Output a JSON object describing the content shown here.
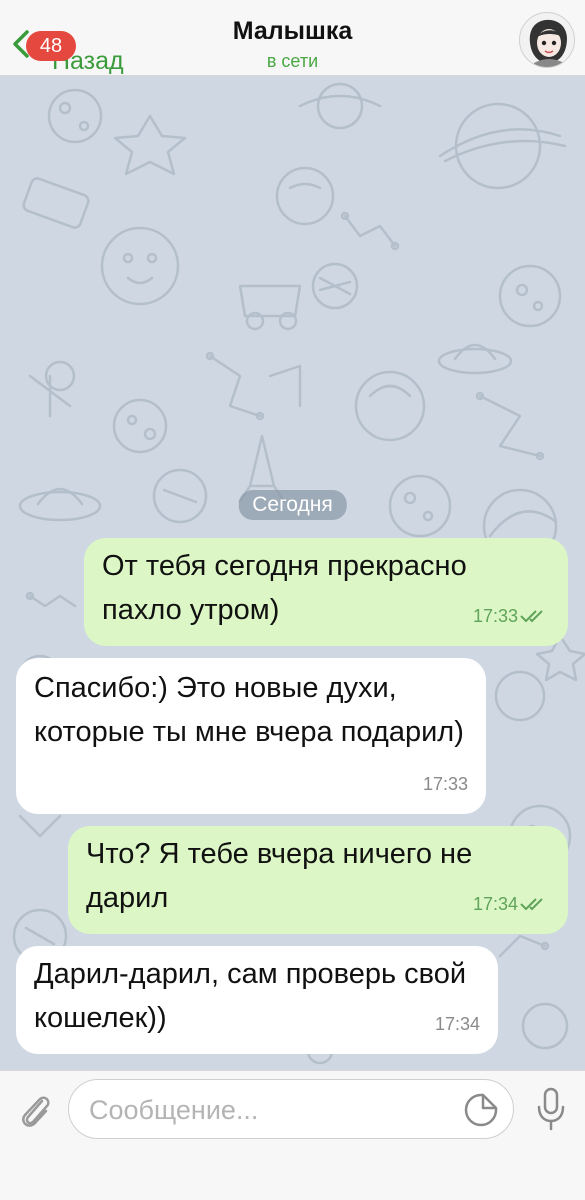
{
  "header": {
    "back_label": "Назад",
    "unread_badge": "48",
    "chat_title": "Малышка",
    "chat_status": "в сети",
    "avatar_icon": "avatar-illustration"
  },
  "chat": {
    "date_divider": "Сегодня",
    "messages": [
      {
        "direction": "out",
        "text": "От тебя сегодня прекрасно пахло утром)",
        "time": "17:33",
        "read": true
      },
      {
        "direction": "in",
        "text": "Спасибо:) Это новые духи, которые ты мне вчера подарил)",
        "time": "17:33"
      },
      {
        "direction": "out",
        "text": "Что? Я тебе вчера ничего не дарил",
        "time": "17:34",
        "read": true
      },
      {
        "direction": "in",
        "text": "Дарил-дарил, сам проверь свой кошелек))",
        "time": "17:34"
      }
    ]
  },
  "input": {
    "placeholder": "Сообщение...",
    "attach_icon": "paperclip-icon",
    "sticker_icon": "sticker-icon",
    "mic_icon": "microphone-icon"
  },
  "colors": {
    "accent": "#3a9b3a",
    "badge": "#e5483f",
    "outgoing_bubble": "#dcf7c5",
    "incoming_bubble": "#ffffff",
    "chat_background": "#cfd7e2"
  }
}
